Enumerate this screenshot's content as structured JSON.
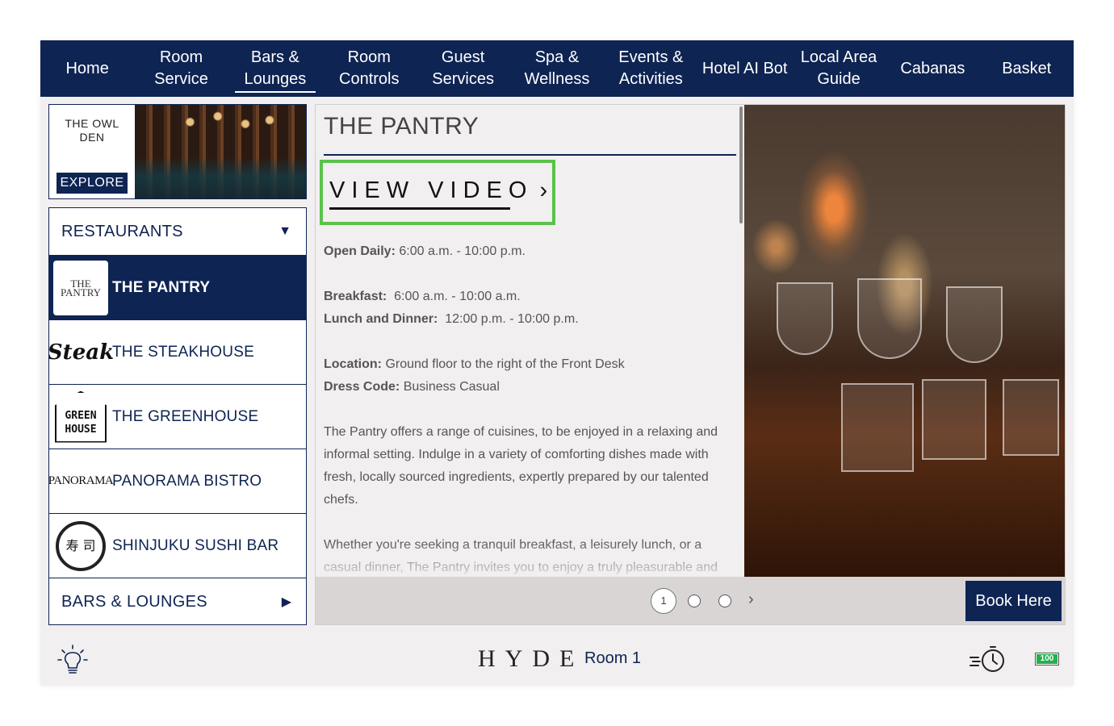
{
  "nav": {
    "items": [
      {
        "label": "Home"
      },
      {
        "label": "Room Service"
      },
      {
        "label": "Bars & Lounges"
      },
      {
        "label": "Room Controls"
      },
      {
        "label": "Guest Services"
      },
      {
        "label": "Spa & Wellness"
      },
      {
        "label": "Events & Activities"
      },
      {
        "label": "Hotel AI Bot"
      },
      {
        "label": "Local Area Guide"
      },
      {
        "label": "Cabanas"
      },
      {
        "label": "Basket"
      }
    ],
    "active": "Bars & Lounges"
  },
  "hero": {
    "title": "THE OWL DEN",
    "button": "EXPLORE"
  },
  "menu": {
    "header": "RESTAURANTS",
    "items": [
      {
        "name": "THE PANTRY",
        "logo_text": "THE PANTRY",
        "active": true
      },
      {
        "name": "THE STEAKHOUSE",
        "logo_text": "Steak",
        "active": false
      },
      {
        "name": "THE GREENHOUSE",
        "logo_text": "GREEN HOUSE",
        "active": false
      },
      {
        "name": "PANORAMA BISTRO",
        "logo_text": "PANORAMA",
        "active": false
      },
      {
        "name": "SHINJUKU SUSHI BAR",
        "logo_text": "寿 司",
        "active": false
      }
    ],
    "footer": "BARS & LOUNGES"
  },
  "detail": {
    "title": "THE PANTRY",
    "video_button": "VIEW VIDEO",
    "open_label": "Open Daily:",
    "open_value": "6:00 a.m. - 10:00 p.m.",
    "breakfast_label": "Breakfast:",
    "breakfast_value": "6:00 a.m. - 10:00 a.m.",
    "lunch_label": "Lunch and Dinner:",
    "lunch_value": "12:00 p.m. - 10:00 p.m.",
    "location_label": "Location:",
    "location_value": "Ground floor to the right of the Front Desk",
    "dress_label": "Dress Code:",
    "dress_value": "Business Casual",
    "description_1": "The Pantry offers a range of cuisines, to be enjoyed in a relaxing and informal setting. Indulge in a variety of comforting dishes made with fresh, locally sourced ingredients, expertly prepared by our talented chefs.",
    "description_2": "Whether you're seeking a tranquil breakfast, a leisurely lunch, or a casual dinner, The Pantry invites you to enjoy a truly pleasurable and"
  },
  "pager": {
    "current": "1",
    "pages": 3,
    "book_button": "Book Here"
  },
  "footer": {
    "brand": "HYDE",
    "room": "Room 1",
    "battery": "100",
    "icons": [
      "lightbulb-icon",
      "timer-icon",
      "battery-icon"
    ]
  },
  "colors": {
    "navy": "#0e2453",
    "highlight_green": "#5ac24a",
    "battery_green": "#22b14c",
    "panel_bg": "#f1efef"
  }
}
